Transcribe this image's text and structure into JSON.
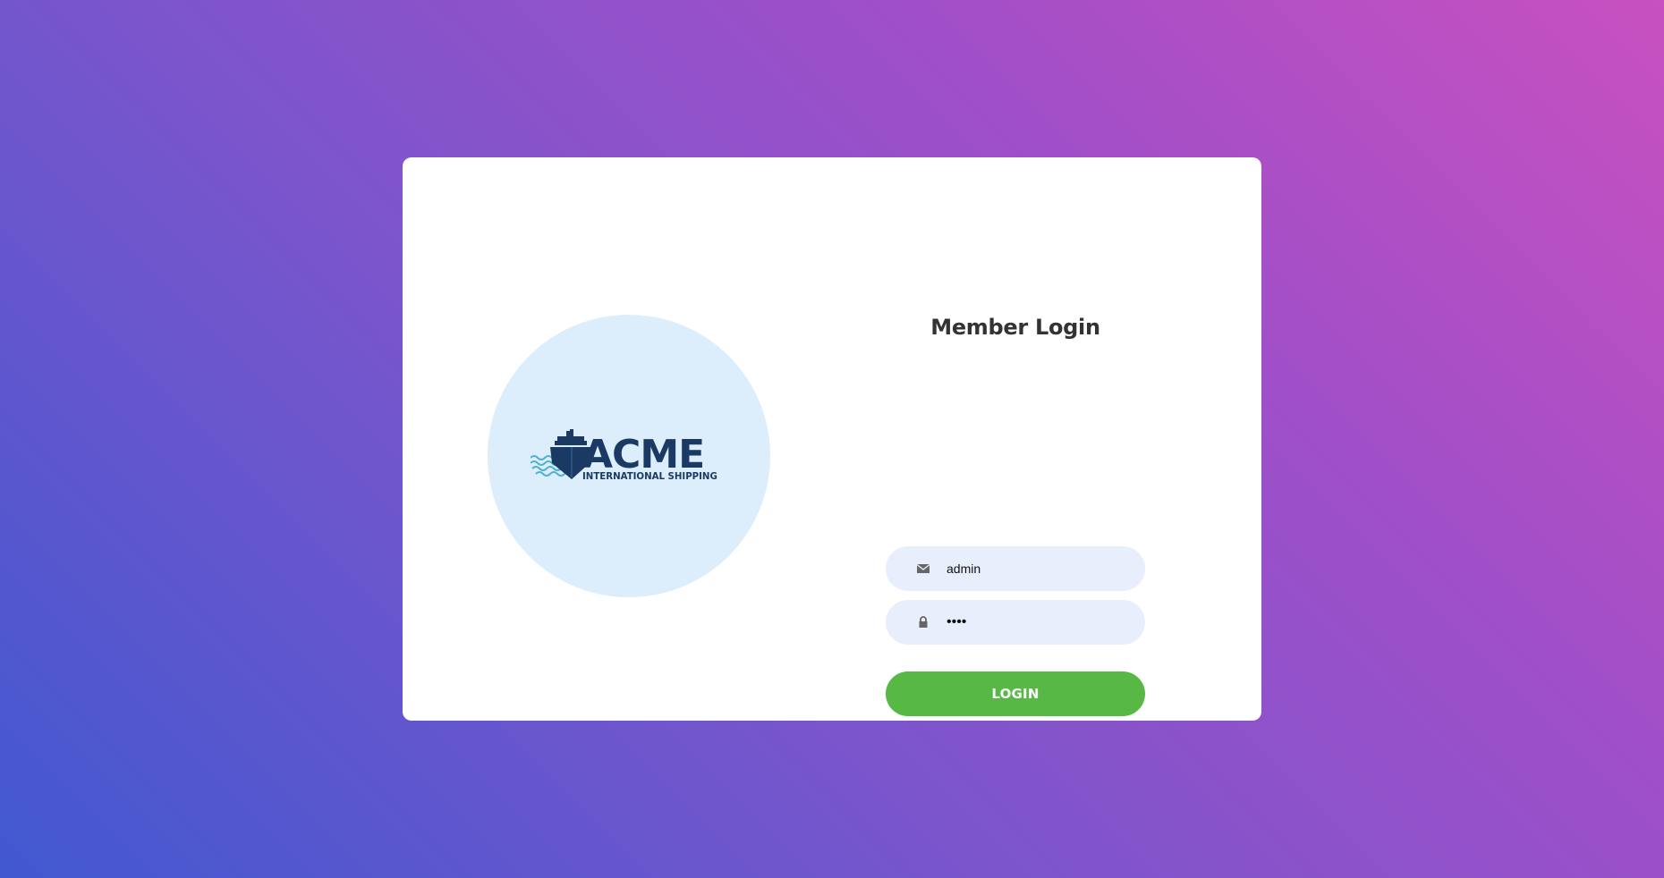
{
  "logo": {
    "brand": "ACME",
    "tagline": "INTERNATIONAL SHIPPING",
    "icon": "ship-icon",
    "circle_color": "#dceefc",
    "brand_color": "#1b3a63",
    "wave_color": "#4fb3cf"
  },
  "form": {
    "title": "Member Login",
    "email": {
      "icon": "envelope-icon",
      "value": "admin"
    },
    "password": {
      "icon": "lock-icon",
      "value": "••••"
    },
    "login_label": "LOGIN"
  },
  "colors": {
    "gradient_start": "#4158d0",
    "gradient_end": "#c850c0",
    "button": "#57b846",
    "field_bg": "#e8eefb"
  }
}
